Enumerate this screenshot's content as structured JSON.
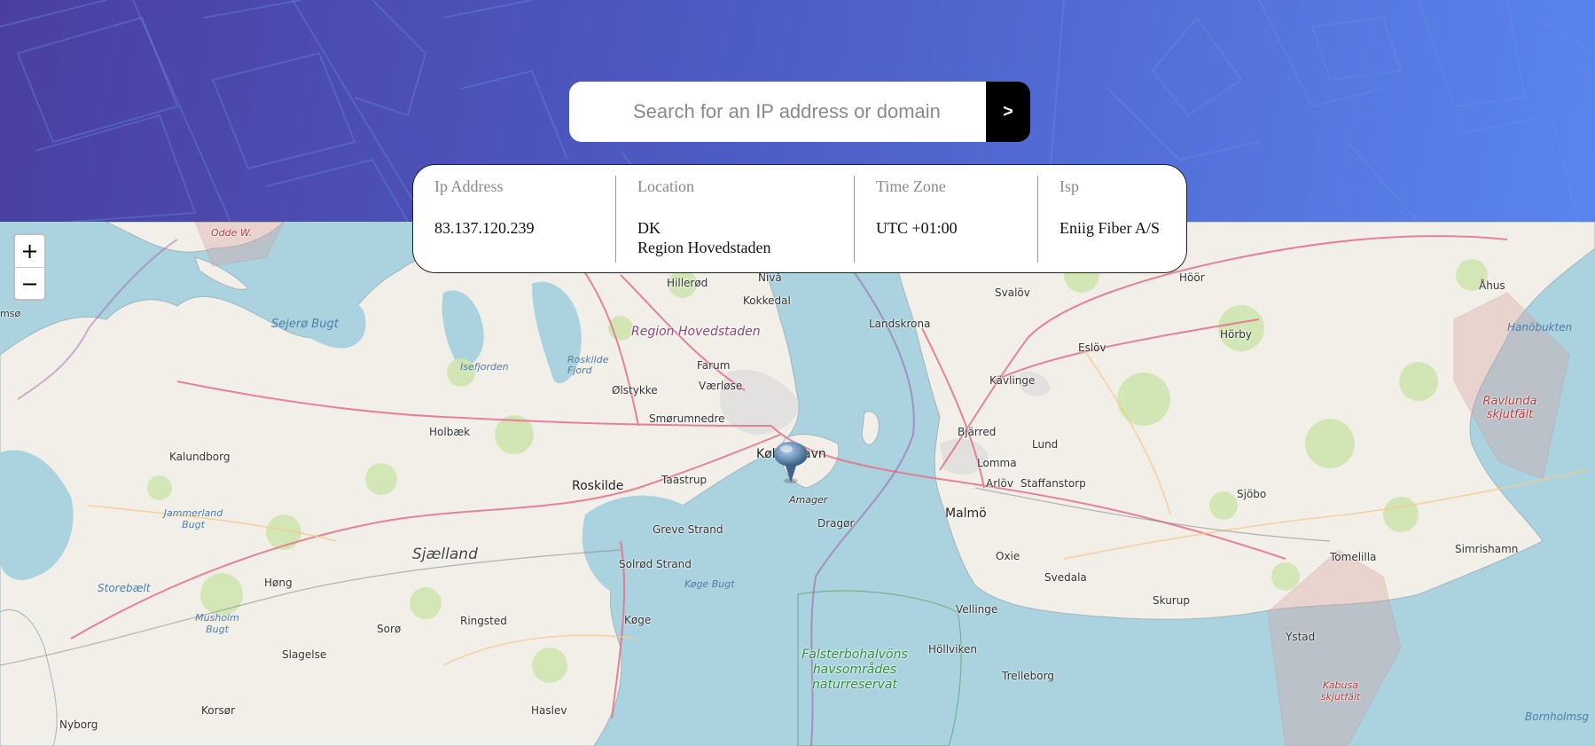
{
  "search": {
    "placeholder": "Search for an IP address or domain",
    "button_label": ">"
  },
  "info": {
    "ip": {
      "label": "Ip Address",
      "value": "83.137.120.239"
    },
    "location": {
      "label": "Location",
      "country": "DK",
      "region": "Region Hovedstaden"
    },
    "timezone": {
      "label": "Time Zone",
      "value": "UTC +01:00"
    },
    "isp": {
      "label": "Isp",
      "value": "Eniig Fiber A/S"
    }
  },
  "map": {
    "zoom_in": "+",
    "zoom_out": "−",
    "labels": {
      "sejero_bugt": "Sejerø Bugt",
      "isefjorden": "Isefjorden",
      "roskilde_fjord": "Roskilde Fjord",
      "region_hovedstaden": "Region Hovedstaden",
      "hillerod": "Hillerød",
      "niva": "Nivå",
      "kokkedal": "Kokkedal",
      "farum": "Farum",
      "vaerlose": "Værløse",
      "olstykke": "Ølstykke",
      "smorumnedre": "Smørumnedre",
      "kobenhavn": "København",
      "taastrup": "Taastrup",
      "amager": "Amager",
      "dragor": "Dragør",
      "roskilde": "Roskilde",
      "greve_strand": "Greve Strand",
      "solrod_strand": "Solrød Strand",
      "koge_bugt": "Køge Bugt",
      "koge": "Køge",
      "holbaek": "Holbæk",
      "kalundborg": "Kalundborg",
      "jammerland_bugt": "Jammerland Bugt",
      "sjaelland": "Sjælland",
      "storebaelt": "Storebælt",
      "hong": "Høng",
      "musholm_bugt": "Musholm Bugt",
      "soro": "Sorø",
      "ringsted": "Ringsted",
      "slagelse": "Slagelse",
      "korsor": "Korsør",
      "haslev": "Haslev",
      "nyborg": "Nyborg",
      "sjaellands_odde": "Sjællands Odde W.",
      "odde_w": "Odde W.",
      "msoe": "msø",
      "hoor": "Höör",
      "svalov": "Svalöv",
      "landskrona": "Landskrona",
      "eslov": "Eslöv",
      "horby": "Hörby",
      "kavlinge": "Kävlinge",
      "bjarred": "Bjärred",
      "lund": "Lund",
      "lomma": "Lomma",
      "arlov": "Arlöv",
      "staffanstorp": "Staffanstorp",
      "malmo": "Malmö",
      "oxie": "Oxie",
      "svedala": "Svedala",
      "skurup": "Skurup",
      "vellinge": "Vellinge",
      "hollviken": "Höllviken",
      "trelleborg": "Trelleborg",
      "sjobo": "Sjöbo",
      "tomelilla": "Tomelilla",
      "simrishamn": "Simrishamn",
      "ystad": "Ystad",
      "ahus": "Åhus",
      "hanobukten": "Hanöbukten",
      "ravlunda": "Ravlunda skjutfält",
      "kabusa": "Kabusa skjutfält",
      "falsterbo": "Falsterbohalvöns havsområdes naturreservat",
      "bornholmsg": "Bornholmsg"
    }
  },
  "colors": {
    "header_start": "#4a3fa0",
    "header_end": "#5a85ee",
    "search_button": "#000000",
    "sea": "#aad3df",
    "land": "#f2efe9",
    "road": "#e4708a"
  },
  "icons": {
    "marker": "map-marker-icon"
  }
}
